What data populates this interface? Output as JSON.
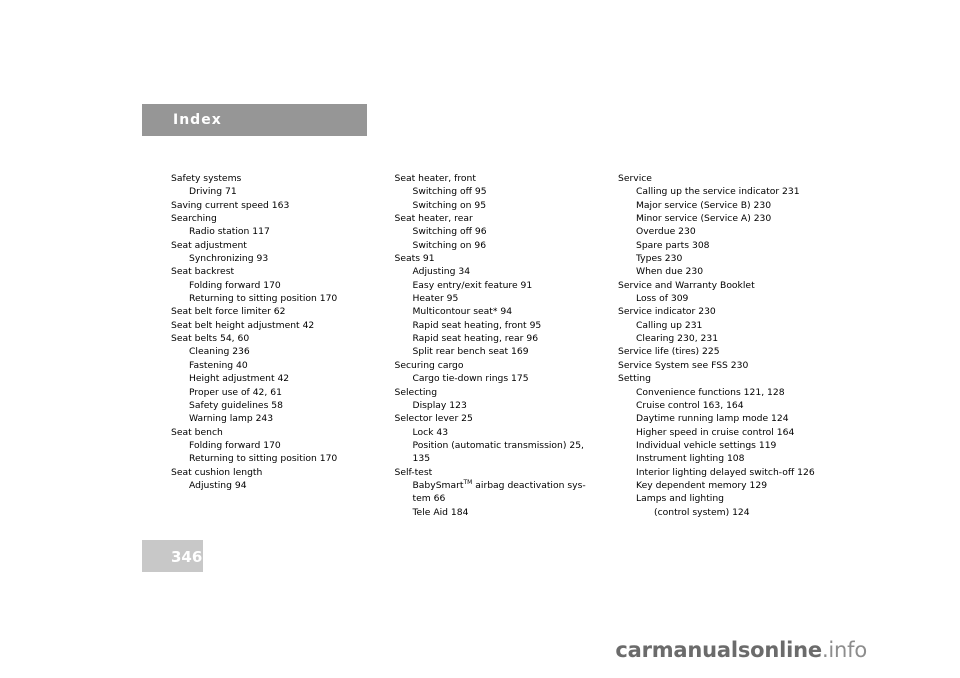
{
  "document": {
    "section_title": "Index",
    "page_number": "346",
    "watermark": "carmanualsonline.info"
  },
  "columns": [
    {
      "entries": [
        {
          "level": 1,
          "text": "Safety systems"
        },
        {
          "level": 2,
          "text": "Driving 71"
        },
        {
          "level": 1,
          "text": "Saving current speed 163"
        },
        {
          "level": 1,
          "text": "Searching"
        },
        {
          "level": 2,
          "text": "Radio station 117"
        },
        {
          "level": 1,
          "text": "Seat adjustment"
        },
        {
          "level": 2,
          "text": "Synchronizing 93"
        },
        {
          "level": 1,
          "text": "Seat backrest"
        },
        {
          "level": 2,
          "text": "Folding forward 170"
        },
        {
          "level": 2,
          "text": "Returning to sitting position 170"
        },
        {
          "level": 1,
          "text": "Seat belt force limiter 62"
        },
        {
          "level": 1,
          "text": "Seat belt height adjustment 42"
        },
        {
          "level": 1,
          "text": "Seat belts 54, 60"
        },
        {
          "level": 2,
          "text": "Cleaning 236"
        },
        {
          "level": 2,
          "text": "Fastening 40"
        },
        {
          "level": 2,
          "text": "Height adjustment 42"
        },
        {
          "level": 2,
          "text": "Proper use of 42, 61"
        },
        {
          "level": 2,
          "text": "Safety guidelines 58"
        },
        {
          "level": 2,
          "text": "Warning lamp 243"
        },
        {
          "level": 1,
          "text": "Seat bench"
        },
        {
          "level": 2,
          "text": "Folding forward 170"
        },
        {
          "level": 2,
          "text": "Returning to sitting position 170"
        },
        {
          "level": 1,
          "text": "Seat cushion length"
        },
        {
          "level": 2,
          "text": "Adjusting 94"
        }
      ]
    },
    {
      "entries": [
        {
          "level": 1,
          "text": "Seat heater, front"
        },
        {
          "level": 2,
          "text": "Switching off 95"
        },
        {
          "level": 2,
          "text": "Switching on 95"
        },
        {
          "level": 1,
          "text": "Seat heater, rear"
        },
        {
          "level": 2,
          "text": "Switching off 96"
        },
        {
          "level": 2,
          "text": "Switching on 96"
        },
        {
          "level": 1,
          "text": "Seats 91"
        },
        {
          "level": 2,
          "text": "Adjusting 34"
        },
        {
          "level": 2,
          "text": "Easy entry/exit feature 91"
        },
        {
          "level": 2,
          "text": "Heater 95"
        },
        {
          "level": 2,
          "text": "Multicontour seat* 94"
        },
        {
          "level": 2,
          "text": "Rapid seat heating, front 95"
        },
        {
          "level": 2,
          "text": "Rapid seat heating, rear 96"
        },
        {
          "level": 2,
          "text": "Split rear bench seat 169"
        },
        {
          "level": 1,
          "text": "Securing cargo"
        },
        {
          "level": 2,
          "text": "Cargo tie-down rings 175"
        },
        {
          "level": 1,
          "text": "Selecting"
        },
        {
          "level": 2,
          "text": "Display 123"
        },
        {
          "level": 1,
          "text": "Selector lever 25"
        },
        {
          "level": 2,
          "text": "Lock 43"
        },
        {
          "level": 2,
          "text": "Position (automatic transmission) 25, 135",
          "wrap": true
        },
        {
          "level": 1,
          "text": "Self-test"
        },
        {
          "level": 2,
          "text": "BabySmart<sup>TM</sup> airbag deactivation sys-tem 66",
          "html": true,
          "wrap": true
        },
        {
          "level": 2,
          "text": "Tele Aid 184"
        }
      ]
    },
    {
      "entries": [
        {
          "level": 1,
          "text": "Service"
        },
        {
          "level": 2,
          "text": "Calling up the service indicator 231"
        },
        {
          "level": 2,
          "text": "Major service (Service B) 230"
        },
        {
          "level": 2,
          "text": "Minor service (Service A) 230"
        },
        {
          "level": 2,
          "text": "Overdue 230"
        },
        {
          "level": 2,
          "text": "Spare parts 308"
        },
        {
          "level": 2,
          "text": "Types 230"
        },
        {
          "level": 2,
          "text": "When due 230"
        },
        {
          "level": 1,
          "text": "Service and Warranty Booklet"
        },
        {
          "level": 2,
          "text": "Loss of 309"
        },
        {
          "level": 1,
          "text": "Service indicator 230"
        },
        {
          "level": 2,
          "text": "Calling up 231"
        },
        {
          "level": 2,
          "text": "Clearing 230, 231"
        },
        {
          "level": 1,
          "text": "Service life (tires) 225"
        },
        {
          "level": 1,
          "text": "Service System see FSS 230"
        },
        {
          "level": 1,
          "text": "Setting"
        },
        {
          "level": 2,
          "text": "Convenience functions 121, 128"
        },
        {
          "level": 2,
          "text": "Cruise control 163, 164"
        },
        {
          "level": 2,
          "text": "Daytime running lamp mode 124"
        },
        {
          "level": 2,
          "text": "Higher speed in cruise control 164"
        },
        {
          "level": 2,
          "text": "Individual vehicle settings 119"
        },
        {
          "level": 2,
          "text": "Instrument lighting 108"
        },
        {
          "level": 2,
          "text": "Interior lighting delayed switch-off 126"
        },
        {
          "level": 2,
          "text": "Key dependent memory 129"
        },
        {
          "level": 2,
          "text": "Lamps and lighting"
        },
        {
          "level": 3,
          "text": "(control system) 124"
        }
      ]
    }
  ]
}
